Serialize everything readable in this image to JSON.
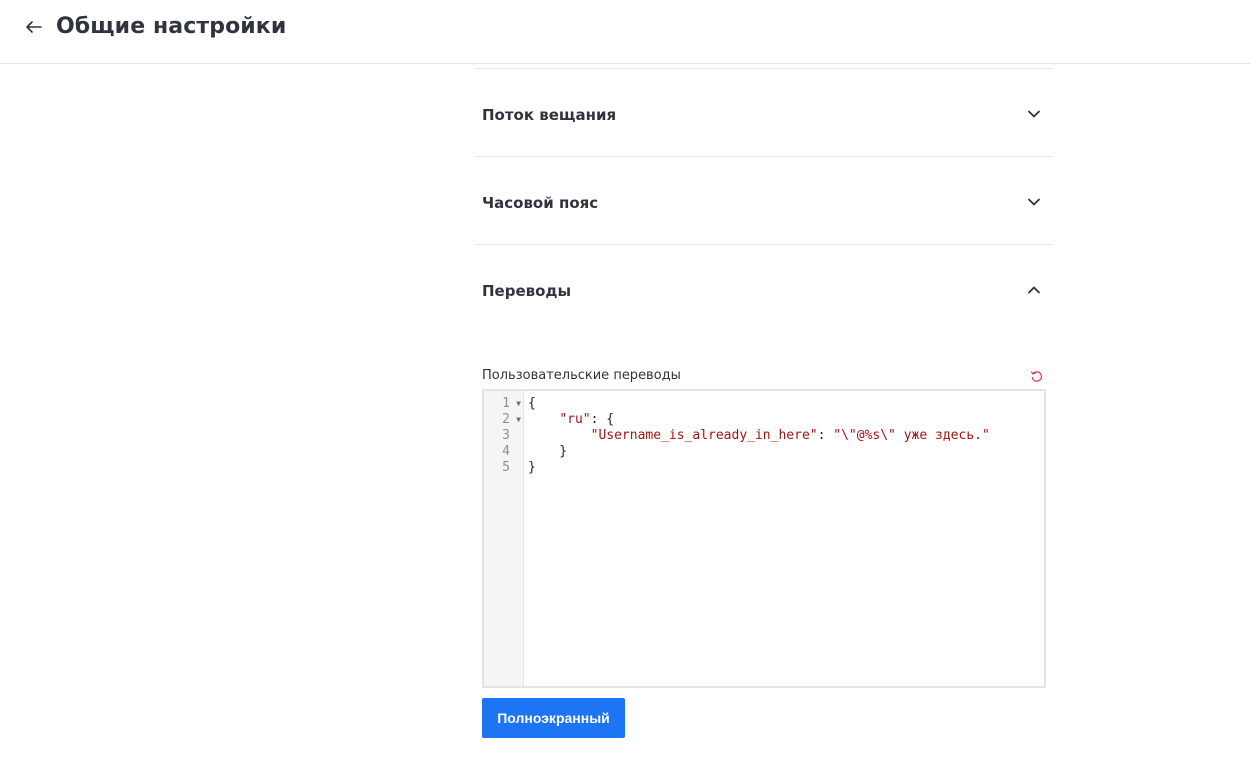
{
  "header": {
    "back_icon": "arrow-left-icon",
    "title": "Общие настройки"
  },
  "sections": [
    {
      "title": "Поток вещания",
      "expanded": false,
      "icon": "chevron-down-icon"
    },
    {
      "title": "Часовой пояс",
      "expanded": false,
      "icon": "chevron-up-icon"
    },
    {
      "title": "Переводы",
      "expanded": true,
      "icon": "chevron-up-icon"
    }
  ],
  "translations": {
    "label": "Пользовательские переводы",
    "reset_icon": "reset-icon",
    "reset_color": "#e0364f",
    "editor": {
      "line_numbers": [
        "1",
        "2",
        "3",
        "4",
        "5"
      ],
      "lines": [
        "{",
        "    \"ru\": {",
        "        \"Username_is_already_in_here\": \"\\\"@%s\\\" уже здесь.\"",
        "    }",
        "}"
      ]
    },
    "fullscreen_button": "Полноэкранный"
  },
  "colors": {
    "primary": "#1d74f5",
    "text": "#2f343d",
    "divider": "#e4e7ea",
    "string": "#a31515"
  }
}
